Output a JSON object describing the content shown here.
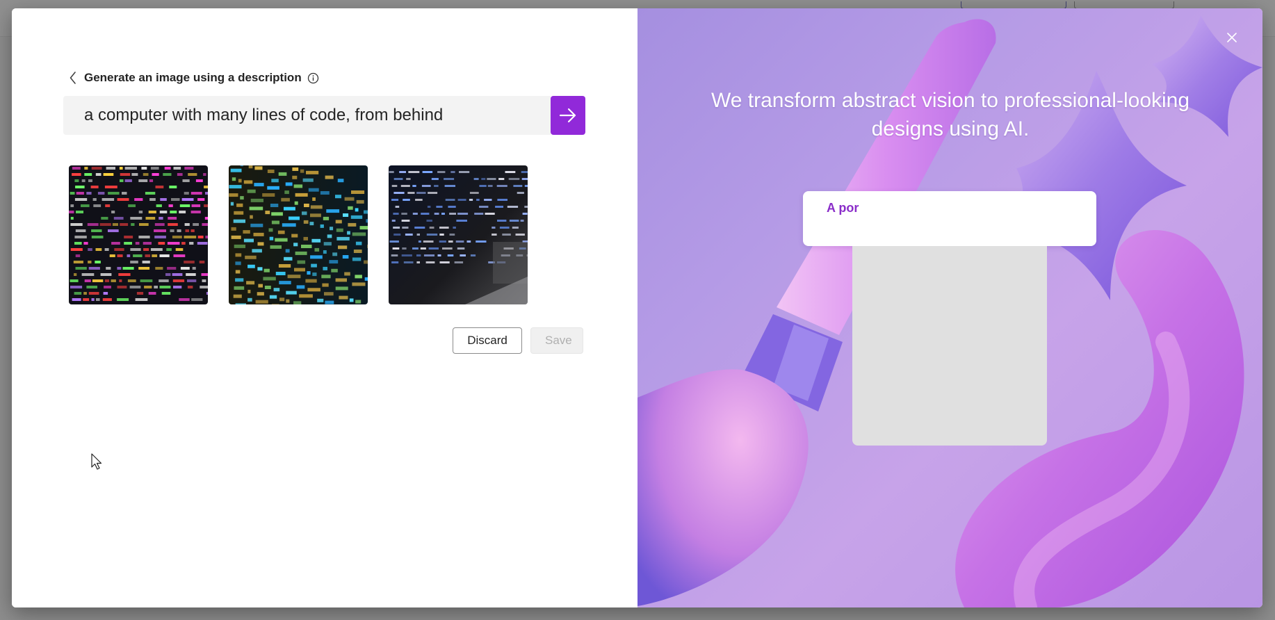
{
  "dialog": {
    "title": "Generate an image using a description",
    "prompt": {
      "value": "a computer with many lines of code, from behind",
      "placeholder": ""
    },
    "thumbnails": [
      {
        "label": "generated-image-1"
      },
      {
        "label": "generated-image-2"
      },
      {
        "label": "generated-image-3"
      }
    ],
    "discard_label": "Discard",
    "save_label": "Save"
  },
  "promo": {
    "headline": "We transform abstract vision to professional-looking designs using AI.",
    "demo_text": "A por"
  },
  "colors": {
    "accent": "#9129d9",
    "promo_text": "#8a2dc9",
    "promo_bg": "#b59be6"
  },
  "icons": {
    "back": "chevron-left-icon",
    "info": "info-icon",
    "send": "arrow-right-icon",
    "close": "close-icon"
  }
}
